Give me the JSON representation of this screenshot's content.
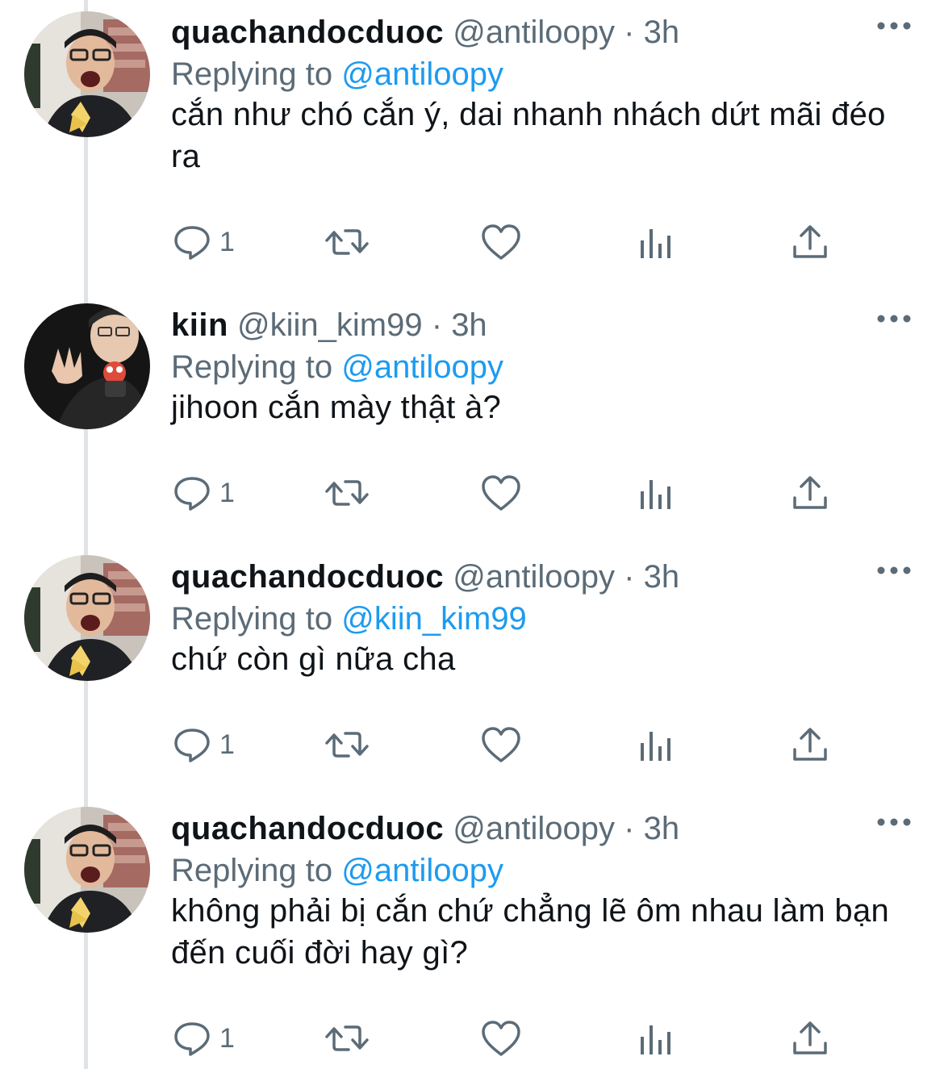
{
  "colors": {
    "text": "#0f1419",
    "secondary": "#5b6b77",
    "link": "#1d9bf0",
    "thread_line": "#dfe3e6"
  },
  "tweets": [
    {
      "author": "quachandocduoc",
      "handle": "@antiloopy",
      "separator": "·",
      "time": "3h",
      "replying_prefix": "Replying to ",
      "replying_to": "@antiloopy",
      "text": "cắn như chó cắn ý, dai nhanh nhách dứt mãi đéo ra",
      "reply_count": "1",
      "avatar": "avatar-quachandocduoc"
    },
    {
      "author": "kiin",
      "handle": "@kiin_kim99",
      "separator": "·",
      "time": "3h",
      "replying_prefix": "Replying to ",
      "replying_to": "@antiloopy",
      "text": "jihoon cắn mày thật à?",
      "reply_count": "1",
      "avatar": "avatar-kiin"
    },
    {
      "author": "quachandocduoc",
      "handle": "@antiloopy",
      "separator": "·",
      "time": "3h",
      "replying_prefix": "Replying to ",
      "replying_to": "@kiin_kim99",
      "text": "chứ còn gì nữa cha",
      "reply_count": "1",
      "avatar": "avatar-quachandocduoc"
    },
    {
      "author": "quachandocduoc",
      "handle": "@antiloopy",
      "separator": "·",
      "time": "3h",
      "replying_prefix": "Replying to ",
      "replying_to": "@antiloopy",
      "text": "không phải bị cắn chứ chẳng lẽ ôm nhau làm bạn đến cuối đời hay gì?",
      "reply_count": "1",
      "avatar": "avatar-quachandocduoc"
    }
  ],
  "icons": {
    "more": "more-horizontal-icon",
    "reply": "reply-bubble-icon",
    "retweet": "retweet-icon",
    "like": "heart-icon",
    "analytics": "analytics-bars-icon",
    "share": "share-upload-icon"
  }
}
